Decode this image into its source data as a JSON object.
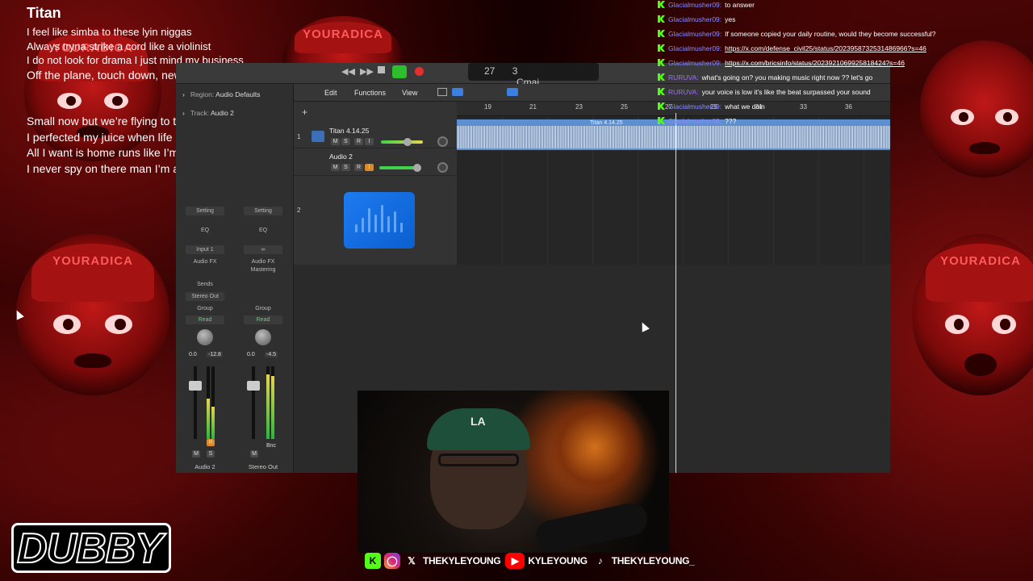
{
  "overlay": {
    "background_avatar_text": "YOURADICA"
  },
  "lyrics": {
    "title": "Titan",
    "lines": [
      "I feel like simba to these lyin niggas",
      "Always tryna strike a cord like a violinist",
      "I do not look for drama I just mind my business"
    ],
    "line4": "Off the plane, touch down, new line of scrimmage",
    "verse2": [
      "Small now but we’re flying to the outer limits",
      "I perfected my juice when life provided lemons",
      "All I want is home runs like I’m Roger Clemens",
      "I never spy on there man I’m a darker venom"
    ]
  },
  "daw": {
    "lcd": {
      "bar": "27",
      "beat": "3",
      "key": "Cmaj"
    },
    "inspector": {
      "region_label": "Region:",
      "region_value": "Audio Defaults",
      "track_label": "Track:",
      "track_value": "Audio 2"
    },
    "menus": {
      "edit": "Edit",
      "functions": "Functions",
      "view": "View"
    },
    "ruler": [
      "19",
      "21",
      "23",
      "25",
      "27",
      "29",
      "31",
      "33",
      "36"
    ],
    "tracks": [
      {
        "number": "1",
        "name": "Titan 4.14.25",
        "m": "M",
        "s": "S",
        "r": "R",
        "i": "I"
      },
      {
        "number": "",
        "name": "Audio 2",
        "m": "M",
        "s": "S",
        "r": "R",
        "i": "I"
      },
      {
        "number": "2",
        "name": ""
      }
    ],
    "region_label": "Titan 4.14.25",
    "channel_strips": [
      {
        "setting": "Setting",
        "eq": "EQ",
        "input": "Input 1",
        "fx": "Audio FX",
        "sends": "Sends",
        "output": "Stereo Out",
        "group": "Group",
        "automation": "Read",
        "pan_value": "0.0",
        "level": "-12.8",
        "m": "M",
        "s": "S",
        "name": "Audio 2"
      },
      {
        "setting": "Setting",
        "eq": "EQ",
        "input": "∞",
        "fx": "Audio FX",
        "fx2": "Mastering",
        "group": "Group",
        "automation": "Read",
        "pan_value": "0.0",
        "level": "-4.5",
        "m": "M",
        "bnc": "Bnc",
        "name": "Stereo Out"
      }
    ]
  },
  "chat": [
    {
      "user": "Glacialmusher09:",
      "message": "to answer",
      "link": false
    },
    {
      "user": "Glacialmusher09:",
      "message": "yes",
      "link": false
    },
    {
      "user": "Glacialmusher09:",
      "message": "If someone copied your daily routine, would they become successful?",
      "link": false
    },
    {
      "user": "Glacialmusher09:",
      "message": "https://x.com/defense_civil25/status/2023958732531486966?s=46",
      "link": true
    },
    {
      "user": "Glacialmusher09:",
      "message": "https://x.com/bricsinfo/status/2023921069925818424?s=46",
      "link": true
    },
    {
      "user": "RURUVA:",
      "message": "what's going on? you making music right now ?? let's go",
      "link": false,
      "alt": true
    },
    {
      "user": "RURUVA:",
      "message": "your voice is low it's like the beat surpassed your sound",
      "link": false,
      "alt": true
    },
    {
      "user": "Glacialmusher09:",
      "message": "what we doin",
      "link": false
    },
    {
      "user": "Glacialmusher09:",
      "message": "???",
      "link": false
    }
  ],
  "socials": {
    "kick_icon": "K",
    "x_handle": "THEKYLEYOUNG",
    "youtube_handle": "KYLEYOUNG",
    "tiktok_handle": "THEKYLEYOUNG_"
  },
  "brand": {
    "logo": "DUBBY"
  },
  "colors": {
    "background_red": "#8a1010",
    "kick_green": "#53fc18",
    "daw_region_blue": "#5b8fd0",
    "play_green": "#2dbd2d",
    "record_red": "#e23030"
  }
}
